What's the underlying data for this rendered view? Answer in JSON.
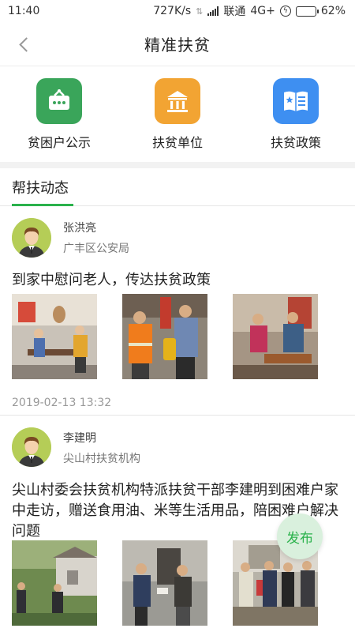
{
  "status_bar": {
    "time": "11:40",
    "network_speed": "727K/s",
    "carrier": "联通",
    "network_type": "4G+",
    "battery": "62%",
    "battery_level": 0.62
  },
  "nav": {
    "title": "精准扶贫"
  },
  "quick_links": [
    {
      "label": "贫困户公示",
      "icon": "poor-household-board-icon",
      "color": "#3aa55a"
    },
    {
      "label": "扶贫单位",
      "icon": "institution-building-icon",
      "color": "#f2a433"
    },
    {
      "label": "扶贫政策",
      "icon": "policy-book-icon",
      "color": "#3e8ff1"
    }
  ],
  "section": {
    "tab_label": "帮扶动态",
    "accent_color": "#2bb24c"
  },
  "posts": [
    {
      "author": "张洪亮",
      "org": "广丰区公安局",
      "text": "到家中慰问老人，传达扶贫政策",
      "time": "2019-02-13 13:32",
      "photo_count": 3
    },
    {
      "author": "李建明",
      "org": "尖山村扶贫机构",
      "text": "尖山村委会扶贫机构特派扶贫干部李建明到困难户家中走访，赠送食用油、米等生活用品，陪困难户解决问题",
      "photo_count": 3
    }
  ],
  "fab": {
    "label": "发布"
  }
}
